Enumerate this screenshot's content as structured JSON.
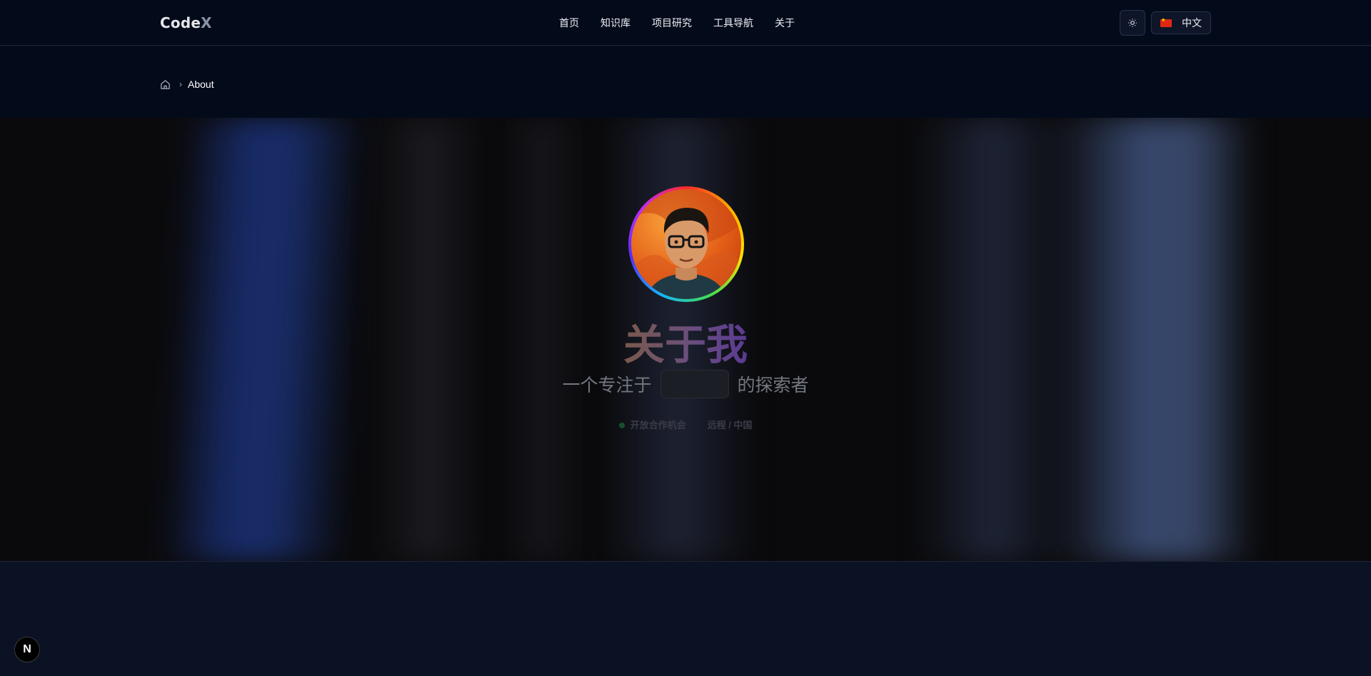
{
  "header": {
    "logo_main": "Code",
    "logo_accent": "X",
    "nav": [
      "首页",
      "知识库",
      "项目研究",
      "工具导航",
      "关于"
    ],
    "language_label": "中文"
  },
  "breadcrumb": {
    "current": "About"
  },
  "hero": {
    "title": "关于我",
    "subtitle_prefix": "一个专注于",
    "subtitle_suffix": "的探索者",
    "status": "开放合作机会",
    "location": "远程 / 中国"
  },
  "dev_badge": "N",
  "colors": {
    "accent_purple": "#5b3a93",
    "status_dot": "#1a4d2a"
  }
}
